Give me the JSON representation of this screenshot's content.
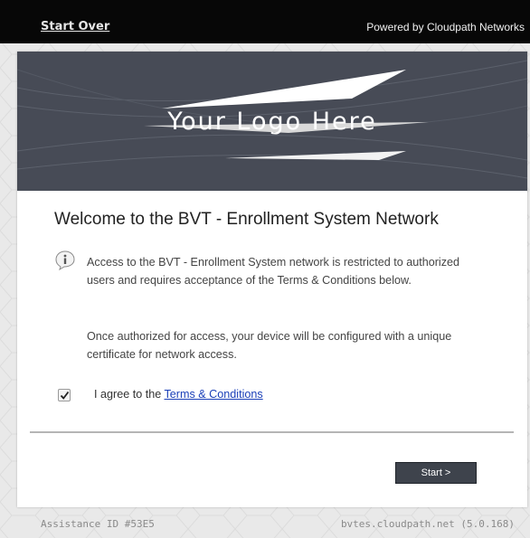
{
  "topbar": {
    "start_over": "Start Over",
    "powered_by": "Powered by Cloudpath Networks"
  },
  "banner": {
    "logo_text": "Your Logo Here"
  },
  "main": {
    "title": "Welcome to the BVT - Enrollment System Network",
    "info_paragraph_1": "Access to the BVT - Enrollment System network is restricted to authorized users and requires acceptance of the Terms & Conditions below.",
    "info_paragraph_2": "Once authorized for access, your device will be configured with a unique certificate for network access.",
    "agree_prefix": "I agree to the",
    "terms_link": "Terms & Conditions",
    "agree_checked": true,
    "start_button": "Start >"
  },
  "footer": {
    "assistance_id": "Assistance ID #53E5",
    "host_version": "bvtes.cloudpath.net (5.0.168)"
  },
  "colors": {
    "topbar": "#070707",
    "banner": "#474b56",
    "button": "#3e434c",
    "link": "#1a3fb8"
  }
}
